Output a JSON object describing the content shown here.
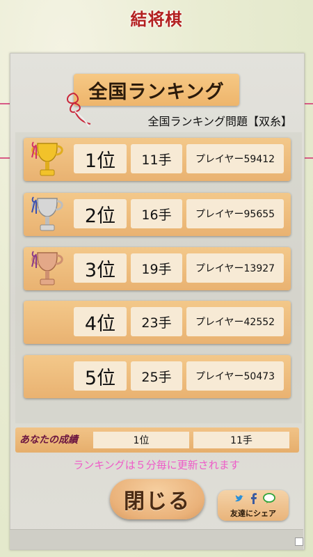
{
  "app": {
    "title": "結将棋"
  },
  "ranking": {
    "header": "全国ランキング",
    "subtitle": "全国ランキング問題【双糸】",
    "rows": [
      {
        "rank": "1位",
        "moves": "11手",
        "player": "プレイヤー59412",
        "trophy": "gold-trophy-icon"
      },
      {
        "rank": "2位",
        "moves": "16手",
        "player": "プレイヤー95655",
        "trophy": "silver-trophy-icon"
      },
      {
        "rank": "3位",
        "moves": "19手",
        "player": "プレイヤー13927",
        "trophy": "bronze-trophy-icon"
      },
      {
        "rank": "4位",
        "moves": "23手",
        "player": "プレイヤー42552",
        "trophy": ""
      },
      {
        "rank": "5位",
        "moves": "25手",
        "player": "プレイヤー50473",
        "trophy": ""
      }
    ]
  },
  "your_result": {
    "label": "あなたの成績",
    "rank": "1位",
    "moves": "11手"
  },
  "notice": "ランキングは５分毎に更新されます",
  "buttons": {
    "close": "閉じる",
    "share": "友達にシェア"
  },
  "colors": {
    "title": "#b32020",
    "notice": "#ee5cc8",
    "wood": "#eeb56c"
  }
}
